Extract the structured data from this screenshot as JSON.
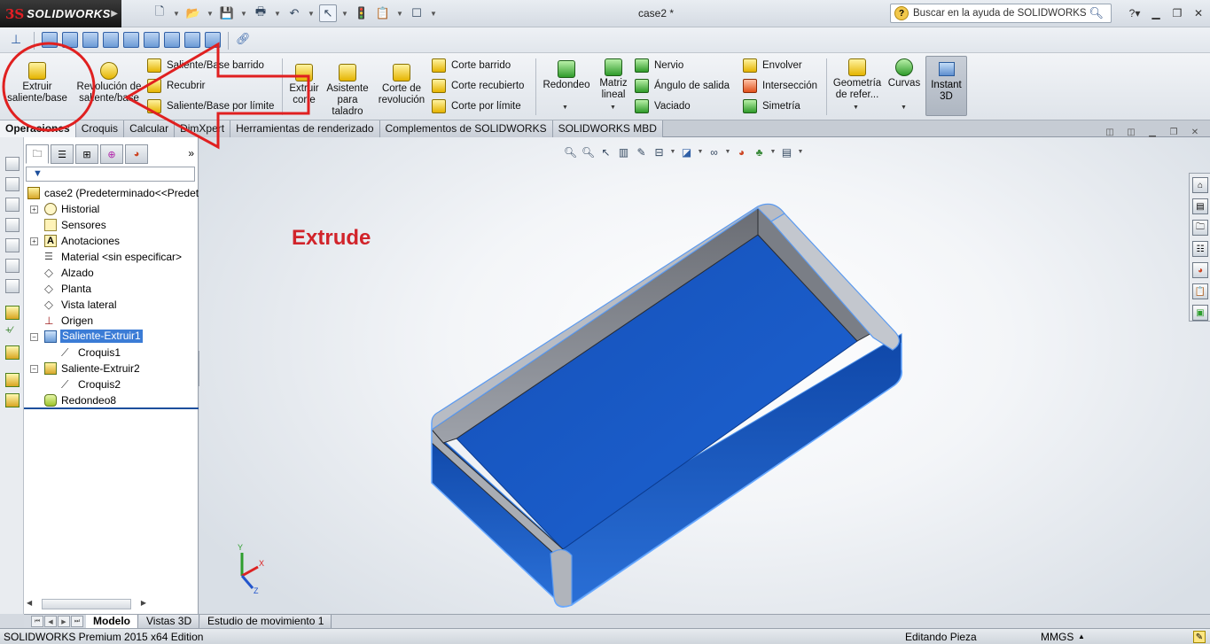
{
  "app": {
    "brand_prefix": "3S",
    "brand": "SOLIDWORKS",
    "document_title": "case2 *"
  },
  "help": {
    "search_placeholder": "Buscar en la ayuda de SOLIDWORKS"
  },
  "ribbon": {
    "extruir": "Extruir saliente/base",
    "revolucion": "Revolución de saliente/base",
    "saliente_barrido": "Saliente/Base barrido",
    "recubrir": "Recubrir",
    "saliente_limite": "Saliente/Base por límite",
    "extruir_corte": "Extruir corte",
    "asistente": "Asistente para taladro",
    "corte_revolucion": "Corte de revolución",
    "corte_barrido": "Corte barrido",
    "corte_recubierto": "Corte recubierto",
    "corte_limite": "Corte por límite",
    "redondeo": "Redondeo",
    "matriz": "Matriz lineal",
    "nervio": "Nervio",
    "angulo": "Ángulo de salida",
    "vaciado": "Vaciado",
    "envolver": "Envolver",
    "interseccion": "Intersección",
    "simetria": "Simetría",
    "geometria": "Geometría de refer...",
    "curvas": "Curvas",
    "instant3d": "Instant 3D"
  },
  "tabs": [
    "Operaciones",
    "Croquis",
    "Calcular",
    "DimXpert",
    "Herramientas de renderizado",
    "Complementos de SOLIDWORKS",
    "SOLIDWORKS MBD"
  ],
  "feature_tree": {
    "root": "case2  (Predeterminado<<Predet",
    "items": [
      {
        "label": "Historial"
      },
      {
        "label": "Sensores"
      },
      {
        "label": "Anotaciones"
      },
      {
        "label": "Material <sin especificar>"
      },
      {
        "label": "Alzado"
      },
      {
        "label": "Planta"
      },
      {
        "label": "Vista lateral"
      },
      {
        "label": "Origen"
      },
      {
        "label": "Saliente-Extruir1"
      },
      {
        "label": "Croquis1"
      },
      {
        "label": "Saliente-Extruir2"
      },
      {
        "label": "Croquis2"
      },
      {
        "label": "Redondeo8"
      }
    ]
  },
  "graphics": {
    "annotation": "Extrude",
    "triad": {
      "x": "X",
      "y": "Y",
      "z": "Z"
    }
  },
  "bottom_tabs": [
    "Modelo",
    "Vistas 3D",
    "Estudio de movimiento 1"
  ],
  "status": {
    "edition": "SOLIDWORKS Premium 2015 x64 Edition",
    "mode": "Editando Pieza",
    "units": "MMGS"
  },
  "colors": {
    "accent_red": "#d1232a",
    "part_blue": "#1f5fc8",
    "selection_blue": "#3b7cd6"
  }
}
